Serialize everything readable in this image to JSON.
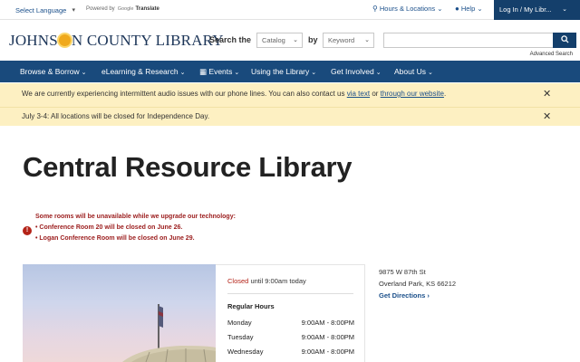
{
  "topbar": {
    "language_select": "Select Language",
    "powered_by": "Powered by",
    "google": "Google",
    "translate": "Translate",
    "hours_locations": "Hours & Locations",
    "help": "Help",
    "login": "Log In / My Libr..."
  },
  "header": {
    "logo_text_left": "JOHNS",
    "logo_text_right": "N COUNTY LIBRARY",
    "search_label": "Search the",
    "catalog_select": "Catalog",
    "by_label": "by",
    "keyword_select": "Keyword",
    "search_input_value": "",
    "advanced_search": "Advanced Search"
  },
  "nav": {
    "items": [
      {
        "label": "Browse & Borrow"
      },
      {
        "label": "eLearning & Research"
      },
      {
        "label": "Events"
      },
      {
        "label": "Using the Library"
      },
      {
        "label": "Get Involved"
      },
      {
        "label": "About Us"
      }
    ]
  },
  "alerts": {
    "alert1_text": "We are currently experiencing intermittent audio issues with our phone lines. You can also contact us",
    "alert1_link1": "via text",
    "alert1_or": "or",
    "alert1_link2": "through our website",
    "alert1_end": ".",
    "alert2_text": "July 3-4: All locations will be closed for Independence Day."
  },
  "main": {
    "title": "Central Resource Library",
    "notice": {
      "line1": "Some rooms will be unavailable while we upgrade our technology:",
      "line2": "• Conference Room 20 will be closed on June 26.",
      "line3": "• Logan Conference Room will be closed on June 29."
    },
    "hours": {
      "status_closed": "Closed",
      "status_rest": "until 9:00am today",
      "heading": "Regular Hours",
      "rows": [
        {
          "day": "Monday",
          "time": "9:00AM - 8:00PM"
        },
        {
          "day": "Tuesday",
          "time": "9:00AM - 8:00PM"
        },
        {
          "day": "Wednesday",
          "time": "9:00AM - 8:00PM"
        }
      ]
    },
    "address": {
      "line1": "9875 W 87th St",
      "line2": "Overland Park, KS 66212",
      "directions": "Get Directions"
    }
  },
  "colors": {
    "nav_blue": "#194a7c",
    "dark_blue": "#143f6b",
    "alert_yellow": "#fdf0c2",
    "closed_red": "#b42318",
    "link_blue": "#1a4f8a"
  }
}
